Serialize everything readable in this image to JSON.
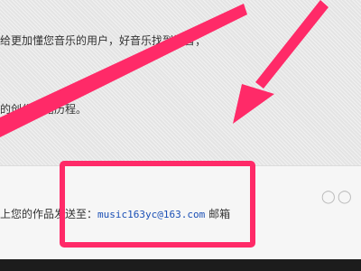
{
  "content": {
    "line1": "给更加懂您音乐的用户，好音乐找到知音；",
    "line2": "的创作心路历程。",
    "line3_prefix": "上您的作品发送至：",
    "email": "music163yc@163.com",
    "line3_suffix": "邮箱"
  },
  "annotation": {
    "color": "#ff2a68"
  }
}
